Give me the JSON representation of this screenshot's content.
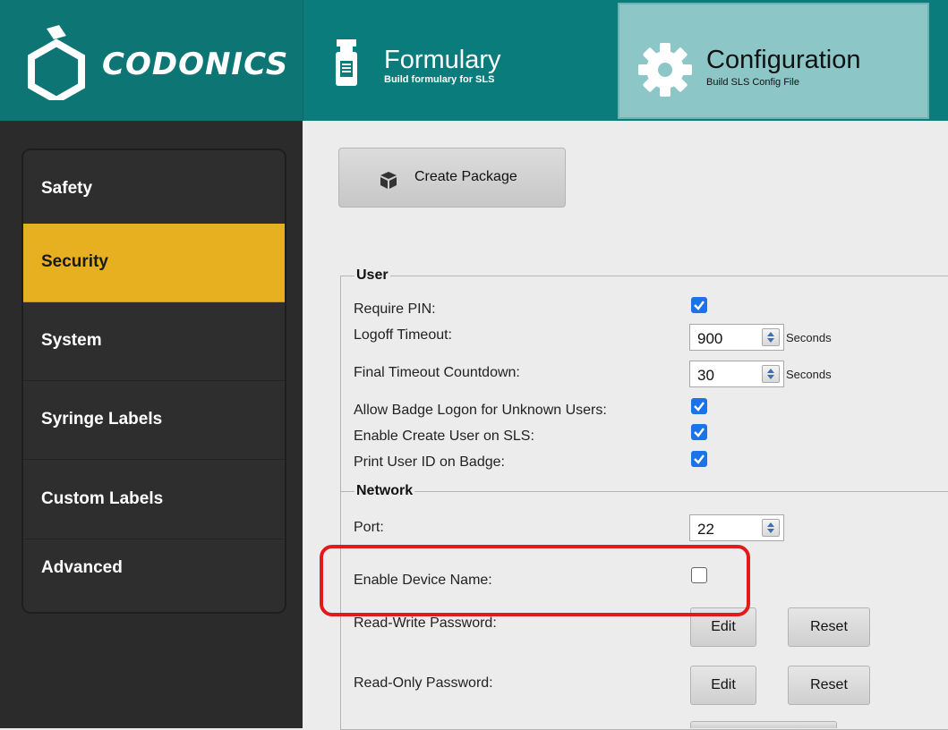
{
  "header": {
    "brand": "CODONICS",
    "tabs": [
      {
        "title": "Formulary",
        "subtitle": "Build formulary for SLS",
        "icon": "bottle-icon"
      },
      {
        "title": "Configuration",
        "subtitle": "Build SLS Config File",
        "icon": "gear-icon"
      }
    ],
    "active_tab": "Configuration"
  },
  "sidebar": {
    "items": [
      {
        "label": "Safety"
      },
      {
        "label": "Security"
      },
      {
        "label": "System"
      },
      {
        "label": "Syringe Labels"
      },
      {
        "label": "Custom Labels"
      },
      {
        "label": "Advanced"
      }
    ],
    "active": "Security",
    "active_color": "#e6b020"
  },
  "toolbar": {
    "create_package_label": "Create Package",
    "create_package_icon": "package-icon"
  },
  "user_section": {
    "legend": "User",
    "require_pin": {
      "label": "Require PIN:",
      "checked": true
    },
    "logoff_timeout": {
      "label": "Logoff Timeout:",
      "value": "900",
      "unit": "Seconds"
    },
    "final_timeout": {
      "label": "Final Timeout Countdown:",
      "value": "30",
      "unit": "Seconds"
    },
    "badge_logon": {
      "label": "Allow Badge Logon for Unknown Users:",
      "checked": true
    },
    "create_user": {
      "label": "Enable Create User on SLS:",
      "checked": true
    },
    "print_user_id": {
      "label": "Print User ID on Badge:",
      "checked": true
    }
  },
  "network_section": {
    "legend": "Network",
    "port": {
      "label": "Port:",
      "value": "22"
    },
    "device_name": {
      "label": "Enable Device Name:",
      "checked": false
    },
    "rw_password": {
      "label": "Read-Write Password:",
      "edit_label": "Edit",
      "reset_label": "Reset"
    },
    "ro_password": {
      "label": "Read-Only Password:",
      "edit_label": "Edit",
      "reset_label": "Reset"
    }
  },
  "colors": {
    "header_teal": "#0b7c7c",
    "active_tab": "#8cc6c6",
    "checkbox_blue": "#1a73e8",
    "highlight_red": "#e21a1a"
  }
}
